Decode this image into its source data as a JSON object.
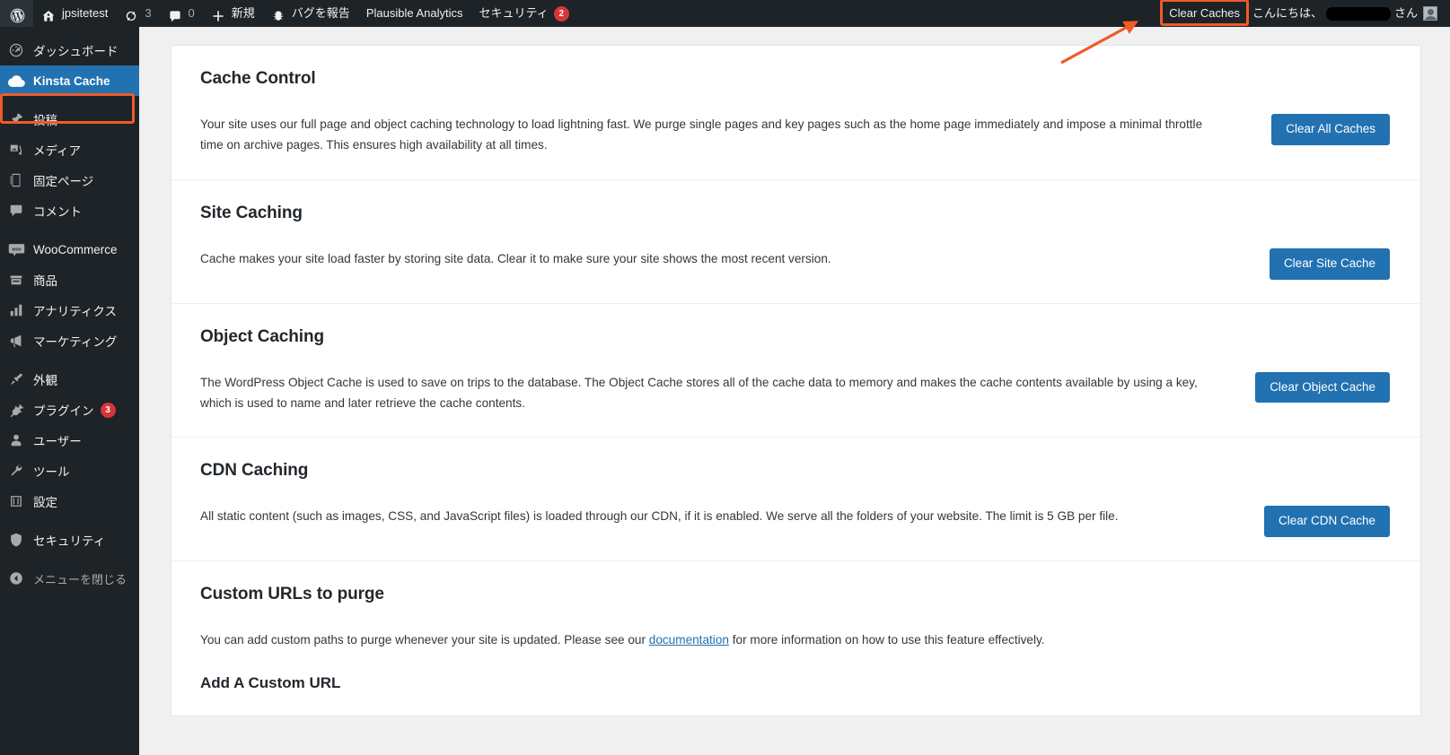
{
  "colors": {
    "accent_blue": "#2271b1",
    "annotation_orange": "#f05a28",
    "admin_dark": "#1d2327",
    "badge_red": "#d63638"
  },
  "adminbar": {
    "wp_logo_label": "WordPress",
    "site_name": "jpsitetest",
    "updates_count": "3",
    "comments_count": "0",
    "new_label": "新規",
    "report_bug_label": "バグを報告",
    "plausible_label": "Plausible Analytics",
    "security_label": "セキュリティ",
    "security_count": "2",
    "clear_caches_label": "Clear Caches",
    "greeting_prefix": "こんにちは、",
    "greeting_suffix": "さん",
    "username_redacted": ""
  },
  "sidebar": {
    "items": [
      {
        "label": "ダッシュボード",
        "icon": "dashboard-icon",
        "current": false,
        "badge": null
      },
      {
        "label": "Kinsta Cache",
        "icon": "cloud-icon",
        "current": true,
        "badge": null
      },
      {
        "label": "投稿",
        "icon": "pin-icon",
        "current": false,
        "badge": null
      },
      {
        "label": "メディア",
        "icon": "media-icon",
        "current": false,
        "badge": null
      },
      {
        "label": "固定ページ",
        "icon": "page-icon",
        "current": false,
        "badge": null
      },
      {
        "label": "コメント",
        "icon": "comment-icon",
        "current": false,
        "badge": null
      },
      {
        "label": "WooCommerce",
        "icon": "woo-icon",
        "current": false,
        "badge": null
      },
      {
        "label": "商品",
        "icon": "products-icon",
        "current": false,
        "badge": null
      },
      {
        "label": "アナリティクス",
        "icon": "chart-icon",
        "current": false,
        "badge": null
      },
      {
        "label": "マーケティング",
        "icon": "megaphone-icon",
        "current": false,
        "badge": null
      },
      {
        "label": "外観",
        "icon": "brush-icon",
        "current": false,
        "badge": null
      },
      {
        "label": "プラグイン",
        "icon": "plug-icon",
        "current": false,
        "badge": "3"
      },
      {
        "label": "ユーザー",
        "icon": "user-icon",
        "current": false,
        "badge": null
      },
      {
        "label": "ツール",
        "icon": "wrench-icon",
        "current": false,
        "badge": null
      },
      {
        "label": "設定",
        "icon": "settings-icon",
        "current": false,
        "badge": null
      },
      {
        "label": "セキュリティ",
        "icon": "shield-icon",
        "current": false,
        "badge": null
      },
      {
        "label": "メニューを閉じる",
        "icon": "collapse-icon",
        "current": false,
        "badge": null
      }
    ]
  },
  "main": {
    "sections": [
      {
        "title": "Cache Control",
        "description": "Your site uses our full page and object caching technology to load lightning fast. We purge single pages and key pages such as the home page immediately and impose a minimal throttle time on archive pages. This ensures high availability at all times.",
        "button": "Clear All Caches"
      },
      {
        "title": "Site Caching",
        "description": "Cache makes your site load faster by storing site data. Clear it to make sure your site shows the most recent version.",
        "button": "Clear Site Cache"
      },
      {
        "title": "Object Caching",
        "description": "The WordPress Object Cache is used to save on trips to the database. The Object Cache stores all of the cache data to memory and makes the cache contents available by using a key, which is used to name and later retrieve the cache contents.",
        "button": "Clear Object Cache"
      },
      {
        "title": "CDN Caching",
        "description": "All static content (such as images, CSS, and JavaScript files) is loaded through our CDN, if it is enabled. We serve all the folders of your website. The limit is 5 GB per file.",
        "button": "Clear CDN Cache"
      }
    ],
    "custom_urls": {
      "title": "Custom URLs to purge",
      "description_before_link": "You can add custom paths to purge whenever your site is updated. Please see our ",
      "link_text": "documentation",
      "description_after_link": " for more information on how to use this feature effectively.",
      "subtitle": "Add A Custom URL"
    }
  }
}
